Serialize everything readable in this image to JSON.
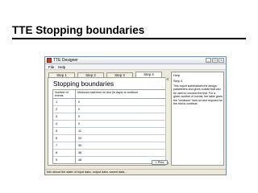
{
  "slide": {
    "title": "TTE Stopping boundaries"
  },
  "window": {
    "title": "TTE Designer",
    "controls": [
      "_",
      "□",
      "×"
    ],
    "menu": [
      "File",
      "Help"
    ]
  },
  "tabs": [
    {
      "label": "Step 1",
      "active": false
    },
    {
      "label": "Step 2",
      "active": false
    },
    {
      "label": "Step 3",
      "active": false
    },
    {
      "label": "Step 4",
      "active": true
    }
  ],
  "panel": {
    "title": "Stopping boundaries",
    "table": {
      "headers": [
        "Number of events",
        "Minimum total time on test (in days) to continue"
      ],
      "rows": [
        [
          "1",
          "0"
        ],
        [
          "2",
          "0"
        ],
        [
          "3",
          "0"
        ],
        [
          "4",
          "0"
        ],
        [
          "5",
          "11"
        ],
        [
          "6",
          "20"
        ],
        [
          "7",
          "30"
        ],
        [
          "8",
          "38"
        ],
        [
          "9",
          "48"
        ]
      ]
    }
  },
  "help": {
    "label": "Help",
    "step": "Step 4",
    "body": "This report summarises the design parameters and gives a table that can be used to conduct the trial. For a given number of events, the table gives the \"minimum\" time-on-test required for the trial to continue."
  },
  "buttons": {
    "prev": "< Prev"
  },
  "status": "Info about the state of input data, output data, saved data..."
}
